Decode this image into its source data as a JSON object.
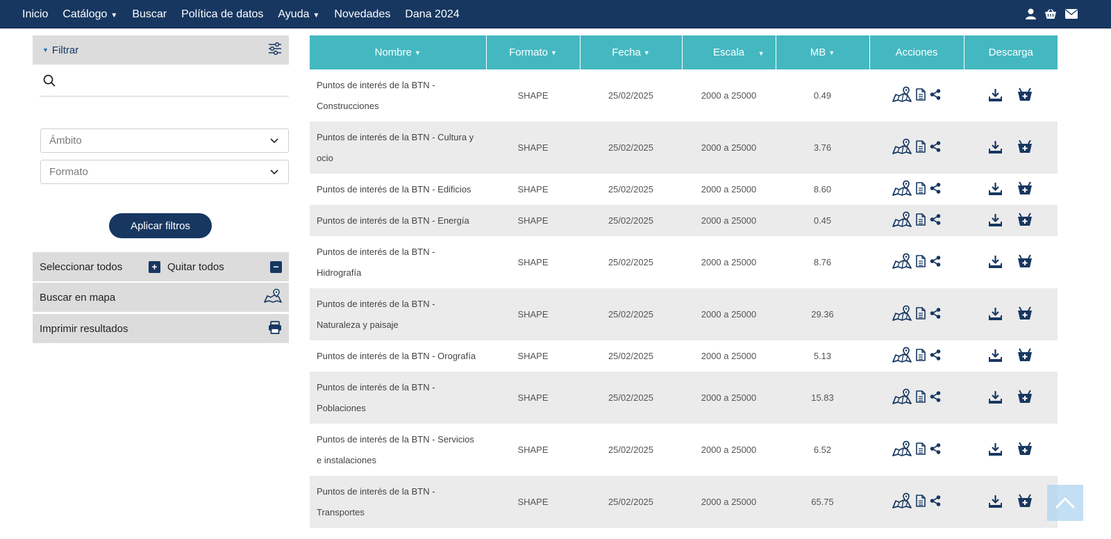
{
  "nav": {
    "items": [
      {
        "label": "Inicio",
        "caret": false
      },
      {
        "label": "Catálogo",
        "caret": true
      },
      {
        "label": "Buscar",
        "caret": false
      },
      {
        "label": "Política de datos",
        "caret": false
      },
      {
        "label": "Ayuda",
        "caret": true
      },
      {
        "label": "Novedades",
        "caret": false
      },
      {
        "label": "Dana 2024",
        "caret": false
      }
    ],
    "icons": [
      "user-icon",
      "basket-icon",
      "mail-icon"
    ]
  },
  "sidebar": {
    "filter_label": "Filtrar",
    "search_placeholder": "",
    "ambito_placeholder": "Ámbito",
    "formato_placeholder": "Formato",
    "apply_label": "Aplicar filtros",
    "select_all_label": "Seleccionar todos",
    "remove_all_label": "Quitar todos",
    "map_search_label": "Buscar en mapa",
    "print_label": "Imprimir resultados"
  },
  "table": {
    "headers": {
      "nombre": "Nombre",
      "formato": "Formato",
      "fecha": "Fecha",
      "escala": "Escala",
      "mb": "MB",
      "acciones": "Acciones",
      "descarga": "Descarga"
    },
    "rows": [
      {
        "nombre": "Puntos de interés de la BTN - Construcciones",
        "formato": "SHAPE",
        "fecha": "25/02/2025",
        "escala": "2000 a 25000",
        "mb": "0.49"
      },
      {
        "nombre": "Puntos de interés de la BTN - Cultura y ocio",
        "formato": "SHAPE",
        "fecha": "25/02/2025",
        "escala": "2000 a 25000",
        "mb": "3.76"
      },
      {
        "nombre": "Puntos de interés de la BTN - Edificios",
        "formato": "SHAPE",
        "fecha": "25/02/2025",
        "escala": "2000 a 25000",
        "mb": "8.60"
      },
      {
        "nombre": "Puntos de interés de la BTN - Energía",
        "formato": "SHAPE",
        "fecha": "25/02/2025",
        "escala": "2000 a 25000",
        "mb": "0.45"
      },
      {
        "nombre": "Puntos de interés de la BTN - Hidrografía",
        "formato": "SHAPE",
        "fecha": "25/02/2025",
        "escala": "2000 a 25000",
        "mb": "8.76"
      },
      {
        "nombre": "Puntos de interés de la BTN - Naturaleza y paisaje",
        "formato": "SHAPE",
        "fecha": "25/02/2025",
        "escala": "2000 a 25000",
        "mb": "29.36"
      },
      {
        "nombre": "Puntos de interés de la BTN - Orografía",
        "formato": "SHAPE",
        "fecha": "25/02/2025",
        "escala": "2000 a 25000",
        "mb": "5.13"
      },
      {
        "nombre": "Puntos de interés de la BTN - Poblaciones",
        "formato": "SHAPE",
        "fecha": "25/02/2025",
        "escala": "2000 a 25000",
        "mb": "15.83"
      },
      {
        "nombre": "Puntos de interés de la BTN - Servicios e instalaciones",
        "formato": "SHAPE",
        "fecha": "25/02/2025",
        "escala": "2000 a 25000",
        "mb": "6.52"
      },
      {
        "nombre": "Puntos de interés de la BTN - Transportes",
        "formato": "SHAPE",
        "fecha": "25/02/2025",
        "escala": "2000 a 25000",
        "mb": "65.75"
      }
    ],
    "action_icons": [
      "map-pin-icon",
      "document-icon",
      "share-icon"
    ],
    "download_icons": [
      "download-icon",
      "add-to-basket-icon"
    ]
  },
  "colors": {
    "nav_bg": "#173761",
    "header_bg": "#44b8c1",
    "stripe": "#ebebeb",
    "icon": "#173761"
  }
}
